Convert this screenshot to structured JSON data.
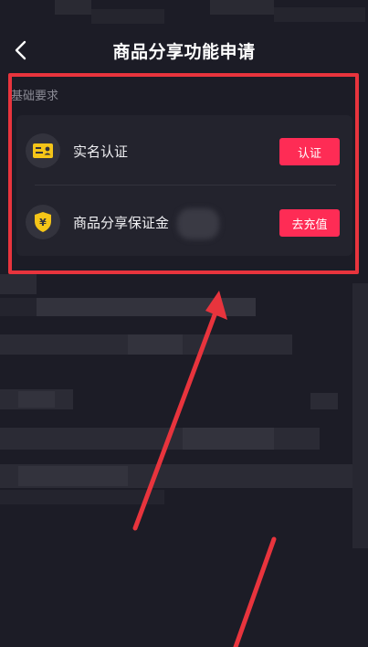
{
  "header": {
    "title": "商品分享功能申请",
    "back_icon": "chevron-left-icon"
  },
  "section": {
    "label": "基础要求",
    "items": [
      {
        "label": "实名认证",
        "icon": "id-card-icon",
        "icon_color": "#f5c518",
        "button_label": "认证"
      },
      {
        "label": "商品分享保证金",
        "icon": "yen-shield-icon",
        "icon_color": "#f5c518",
        "button_label": "去充值"
      }
    ]
  },
  "colors": {
    "accent": "#fe2c55",
    "highlight": "#e8343d",
    "background": "#1c1c26"
  }
}
